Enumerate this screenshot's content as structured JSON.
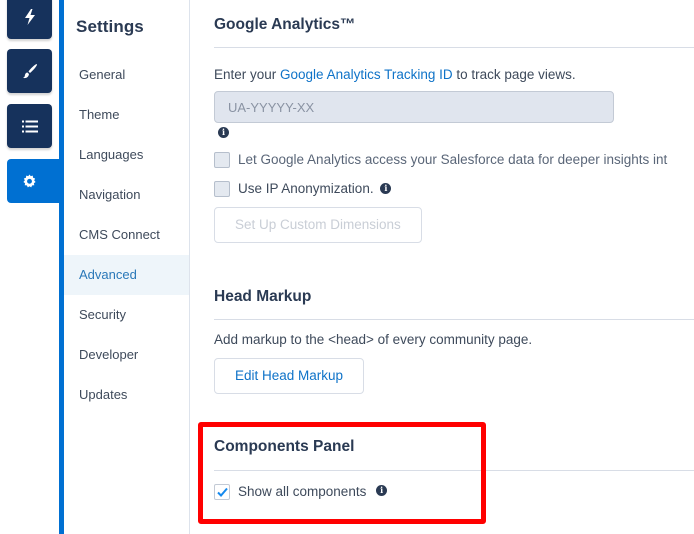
{
  "rail": {
    "items": [
      {
        "icon": "lightning-bolt-icon",
        "label": "Quick Actions"
      },
      {
        "icon": "paintbrush-icon",
        "label": "Theme"
      },
      {
        "icon": "list-icon",
        "label": "Pages"
      },
      {
        "icon": "gear-icon",
        "label": "Settings",
        "active": true
      }
    ],
    "accent_color": "#0070d2",
    "button_color": "#16325c"
  },
  "nav": {
    "title": "Settings",
    "items": [
      {
        "label": "General"
      },
      {
        "label": "Theme"
      },
      {
        "label": "Languages"
      },
      {
        "label": "Navigation"
      },
      {
        "label": "CMS Connect"
      },
      {
        "label": "Advanced",
        "selected": true
      },
      {
        "label": "Security"
      },
      {
        "label": "Developer"
      },
      {
        "label": "Updates"
      }
    ]
  },
  "google_analytics": {
    "title": "Google Analytics™",
    "intro_prefix": "Enter your ",
    "intro_link": "Google Analytics Tracking ID",
    "intro_suffix": " to track page views.",
    "tracking_id_value": "",
    "tracking_id_placeholder": "UA-YYYYY-XX",
    "checkbox_salesforce_label": "Let Google Analytics access your Salesforce data for deeper insights int",
    "checkbox_salesforce_checked": false,
    "checkbox_ip_label": "Use IP Anonymization.",
    "checkbox_ip_checked": false,
    "custom_dimensions_button": "Set Up Custom Dimensions"
  },
  "head_markup": {
    "title": "Head Markup",
    "description": "Add markup to the <head> of every community page.",
    "edit_button": "Edit Head Markup"
  },
  "components_panel": {
    "title": "Components Panel",
    "show_all_label": "Show all components",
    "show_all_checked": true
  },
  "annotation": {
    "highlight_color": "#ff0000"
  }
}
